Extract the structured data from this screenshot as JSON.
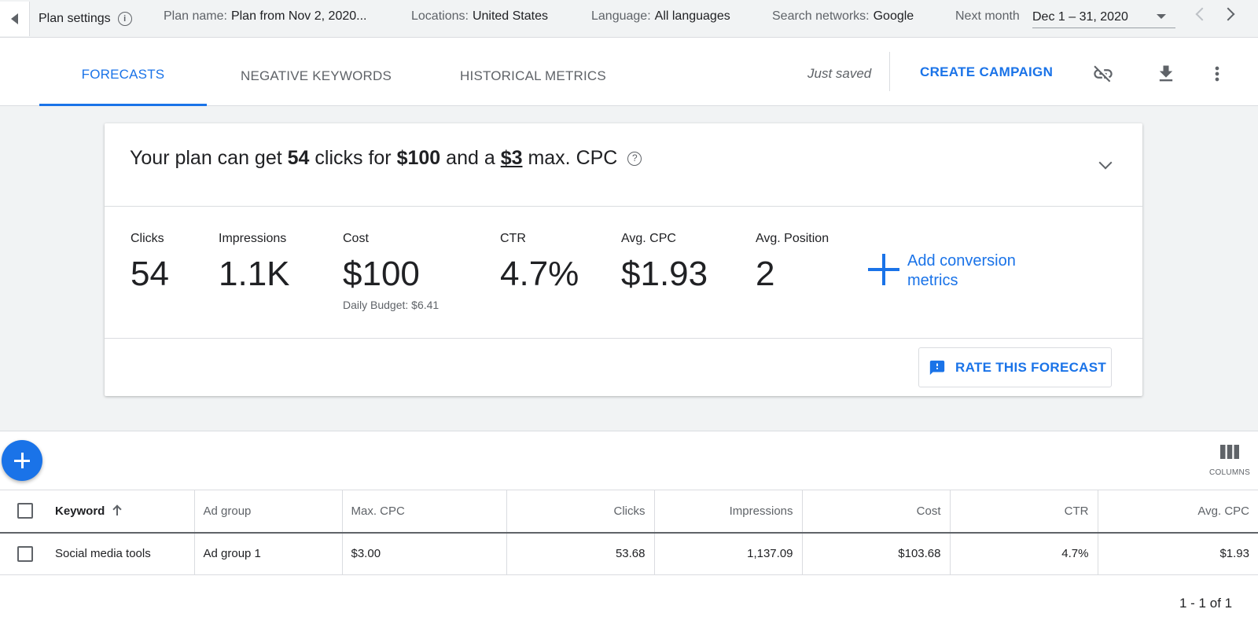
{
  "topbar": {
    "plan_settings_label": "Plan settings",
    "plan_name_label": "Plan name:",
    "plan_name_value": "Plan from Nov 2, 2020...",
    "locations_label": "Locations:",
    "locations_value": "United States",
    "language_label": "Language:",
    "language_value": "All languages",
    "networks_label": "Search networks:",
    "networks_value": "Google",
    "period_label": "Next month",
    "date_range": "Dec 1 – 31, 2020"
  },
  "tabs": [
    {
      "label": "FORECASTS",
      "active": true
    },
    {
      "label": "NEGATIVE KEYWORDS",
      "active": false
    },
    {
      "label": "HISTORICAL METRICS",
      "active": false
    }
  ],
  "header_actions": {
    "save_status": "Just saved",
    "create_campaign_label": "CREATE CAMPAIGN"
  },
  "forecast": {
    "summary_prefix": "Your plan can get",
    "clicks": "54",
    "summary_mid": "clicks for",
    "budget": "$100",
    "summary_and": "and a",
    "max_cpc": "$3",
    "summary_suffix": "max. CPC",
    "metrics": [
      {
        "label": "Clicks",
        "value": "54"
      },
      {
        "label": "Impressions",
        "value": "1.1K"
      },
      {
        "label": "Cost",
        "value": "$100",
        "sub": "Daily Budget: $6.41"
      },
      {
        "label": "CTR",
        "value": "4.7%"
      },
      {
        "label": "Avg. CPC",
        "value": "$1.93"
      },
      {
        "label": "Avg. Position",
        "value": "2"
      }
    ],
    "add_conversion_label": "Add conversion metrics",
    "rate_label": "RATE THIS FORECAST"
  },
  "table": {
    "columns_label": "COLUMNS",
    "headers": [
      "Keyword",
      "Ad group",
      "Max. CPC",
      "Clicks",
      "Impressions",
      "Cost",
      "CTR",
      "Avg. CPC"
    ],
    "rows": [
      [
        "Social media tools",
        "Ad group 1",
        "$3.00",
        "53.68",
        "1,137.09",
        "$103.68",
        "4.7%",
        "$1.93"
      ]
    ],
    "pagination": "1 - 1 of 1"
  },
  "colors": {
    "accent": "#1a73e8",
    "background": "#f1f3f4",
    "text": "#202124",
    "muted": "#5f6368"
  },
  "icons": [
    "back-arrow-icon",
    "info-icon",
    "chevron-down-icon",
    "chevron-left-icon",
    "chevron-right-icon",
    "unlink-icon",
    "download-icon",
    "more-vert-icon",
    "help-icon",
    "plus-icon",
    "feedback-icon",
    "columns-icon",
    "sort-arrow-up-icon"
  ]
}
